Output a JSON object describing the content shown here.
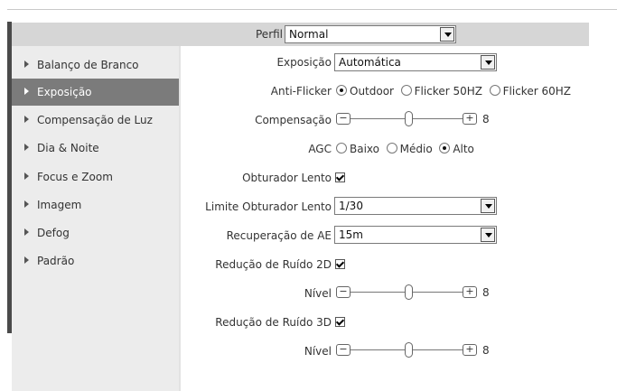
{
  "header": {
    "perfil_label": "Perfil",
    "perfil_value": "Normal"
  },
  "sidebar": {
    "items": [
      {
        "label": "Balanço de Branco",
        "active": false
      },
      {
        "label": "Exposição",
        "active": true
      },
      {
        "label": "Compensação de Luz",
        "active": false
      },
      {
        "label": "Dia & Noite",
        "active": false
      },
      {
        "label": "Focus e Zoom",
        "active": false
      },
      {
        "label": "Imagem",
        "active": false
      },
      {
        "label": "Defog",
        "active": false
      },
      {
        "label": "Padrão",
        "active": false
      }
    ]
  },
  "form": {
    "exposicao": {
      "label": "Exposição",
      "value": "Automática"
    },
    "anti_flicker": {
      "label": "Anti-Flicker",
      "options": [
        "Outdoor",
        "Flicker 50HZ",
        "Flicker 60HZ"
      ],
      "selected": "Outdoor"
    },
    "compensacao": {
      "label": "Compensação",
      "value": "8",
      "minus": "−",
      "plus": "+"
    },
    "agc": {
      "label": "AGC",
      "options": [
        "Baixo",
        "Médio",
        "Alto"
      ],
      "selected": "Alto"
    },
    "obturador_lento": {
      "label": "Obturador Lento",
      "checked": true
    },
    "limite_obturador": {
      "label": "Limite Obturador Lento",
      "value": "1/30"
    },
    "recuperacao_ae": {
      "label": "Recuperação de AE",
      "value": "15m"
    },
    "ruido_2d": {
      "label": "Redução de Ruído 2D",
      "checked": true
    },
    "nivel_2d": {
      "label": "Nível",
      "value": "8"
    },
    "ruido_3d": {
      "label": "Redução de Ruído 3D",
      "checked": true
    },
    "nivel_3d": {
      "label": "Nível",
      "value": "8"
    }
  }
}
